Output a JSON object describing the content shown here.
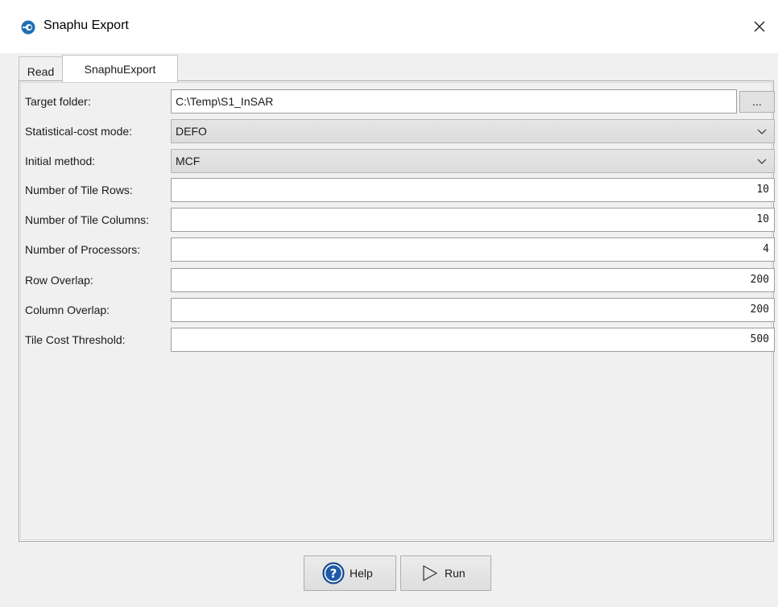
{
  "window": {
    "title": "Snaphu Export",
    "close_icon": "close-icon",
    "app_icon": "esa-icon"
  },
  "tabs": [
    {
      "label": "Read",
      "active": false
    },
    {
      "label": "SnaphuExport",
      "active": true
    }
  ],
  "form": {
    "target_folder": {
      "label": "Target folder:",
      "value": "C:\\Temp\\S1_InSAR",
      "browse_label": "..."
    },
    "stat_cost_mode": {
      "label": "Statistical-cost mode:",
      "value": "DEFO"
    },
    "initial_method": {
      "label": "Initial method:",
      "value": "MCF"
    },
    "tile_rows": {
      "label": "Number of Tile Rows:",
      "value": "10"
    },
    "tile_columns": {
      "label": "Number of Tile Columns:",
      "value": "10"
    },
    "processors": {
      "label": "Number of Processors:",
      "value": "4"
    },
    "row_overlap": {
      "label": "Row Overlap:",
      "value": "200"
    },
    "column_overlap": {
      "label": "Column Overlap:",
      "value": "200"
    },
    "tile_cost_threshold": {
      "label": "Tile Cost Threshold:",
      "value": "500"
    }
  },
  "buttons": {
    "help": {
      "label": "Help",
      "icon": "help-icon"
    },
    "run": {
      "label": "Run",
      "icon": "play-icon"
    }
  },
  "colors": {
    "help_icon": "#1e5aa8",
    "window_bg": "#f0f0f0"
  }
}
